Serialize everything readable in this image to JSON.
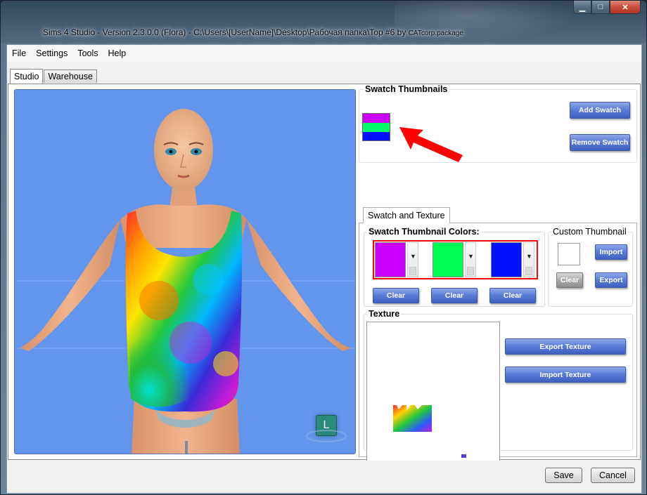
{
  "window": {
    "title_main": "Sims 4 Studio - Version 2.3.0.0  (Flora)    - C:\\Users\\[UserName]\\Desktop\\Рабочая папка\\Top #6 by ",
    "title_small": "CATcorp.package",
    "minimize_glyph": "▁",
    "maximize_glyph": "□",
    "close_glyph": "✕"
  },
  "menu": {
    "items": [
      "File",
      "Settings",
      "Tools",
      "Help"
    ]
  },
  "tabs": {
    "studio": "Studio",
    "warehouse": "Warehouse"
  },
  "viewport": {
    "lod_badge": "L",
    "background_color": "#6495ed"
  },
  "swatch_thumbnails": {
    "title": "Swatch Thumbnails",
    "add_label": "Add Swatch",
    "remove_label": "Remove Swatch",
    "colors": [
      "#cc00ff",
      "#00ff66",
      "#0011ff"
    ]
  },
  "inner_tab": {
    "label": "Swatch and Texture"
  },
  "swatch_colors": {
    "title": "Swatch Thumbnail Colors:",
    "slots": [
      {
        "color": "#cc00ff",
        "clear_label": "Clear"
      },
      {
        "color": "#00ff55",
        "clear_label": "Clear"
      },
      {
        "color": "#0011ff",
        "clear_label": "Clear"
      }
    ]
  },
  "custom_thumbnail": {
    "title": "Custom Thumbnail",
    "import_label": "Import",
    "clear_label": "Clear",
    "export_label": "Export"
  },
  "texture": {
    "title": "Texture",
    "export_label": "Export Texture",
    "import_label": "Import Texture"
  },
  "footer": {
    "save_label": "Save",
    "cancel_label": "Cancel"
  },
  "annotation_color": "#ff0000"
}
